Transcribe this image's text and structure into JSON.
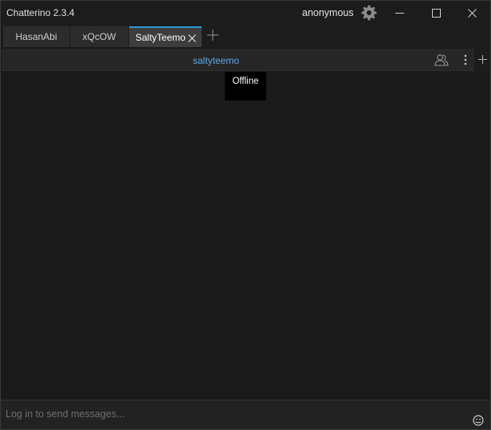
{
  "window": {
    "title": "Chatterino 2.3.4"
  },
  "account": {
    "username": "anonymous"
  },
  "tabs": [
    {
      "label": "HasanAbi",
      "selected": false
    },
    {
      "label": "xQcOW",
      "selected": false
    },
    {
      "label": "SaltyTeemo",
      "selected": true
    }
  ],
  "split": {
    "channel": "saltyteemo"
  },
  "tooltip": {
    "text": "Offline"
  },
  "input": {
    "placeholder": "Log in to send messages..."
  },
  "colors": {
    "accent": "#2e9bd6",
    "channel": "#5ea9e9",
    "background": "#1a1a1a"
  },
  "icons": {
    "settings": "gear-icon",
    "minimize": "minimize-icon",
    "maximize": "maximize-icon",
    "close": "close-icon",
    "add_tab": "plus-icon",
    "viewers": "users-icon",
    "split_menu": "kebab-menu-icon",
    "emotes": "smiley-icon"
  }
}
